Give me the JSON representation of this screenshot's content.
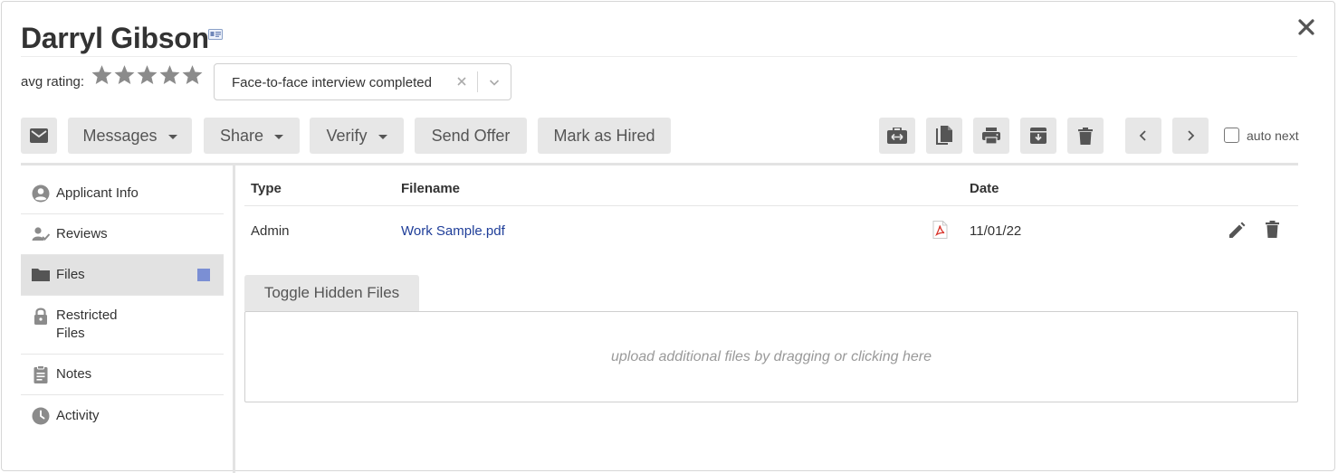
{
  "candidate": {
    "name": "Darryl Gibson"
  },
  "rating": {
    "label": "avg rating:",
    "stars_total": 5,
    "stars_filled": 0
  },
  "status": {
    "selected": "Face-to-face interview completed"
  },
  "toolbar": {
    "messages_label": "Messages",
    "share_label": "Share",
    "verify_label": "Verify",
    "send_offer_label": "Send Offer",
    "mark_hired_label": "Mark as Hired",
    "auto_next_label": "auto next",
    "auto_next_checked": false
  },
  "sidebar": {
    "items": [
      {
        "label": "Applicant Info",
        "icon": "user-circle-icon"
      },
      {
        "label": "Reviews",
        "icon": "user-check-icon"
      },
      {
        "label": "Files",
        "icon": "folder-icon",
        "active": true
      },
      {
        "label_line1": "Restricted",
        "label_line2": "Files",
        "icon": "lock-icon"
      },
      {
        "label": "Notes",
        "icon": "clipboard-icon"
      },
      {
        "label": "Activity",
        "icon": "clock-icon"
      }
    ]
  },
  "files_table": {
    "columns": [
      "Type",
      "Filename",
      "Date"
    ],
    "rows": [
      {
        "type": "Admin",
        "filename": "Work Sample.pdf",
        "date": "11/01/22"
      }
    ]
  },
  "files": {
    "toggle_hidden_label": "Toggle Hidden Files",
    "dropzone_text": "upload additional files by dragging or clicking here"
  },
  "colors": {
    "accent_badge": "#7b8fd4",
    "link": "#1f3e99",
    "button_bg": "#e7e7e7",
    "pdf_red": "#d9342b"
  }
}
